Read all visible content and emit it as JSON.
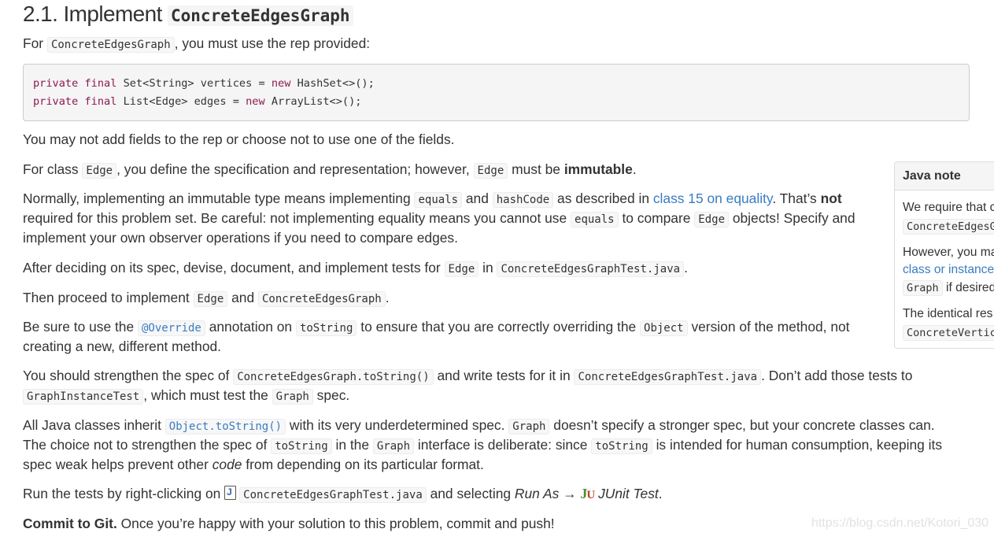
{
  "heading": {
    "prefix": "2.1. Implement",
    "code": "ConcreteEdgesGraph"
  },
  "intro": {
    "t1": "For",
    "c1": "ConcreteEdgesGraph",
    "t2": ", you must use the rep provided:"
  },
  "code_block": {
    "line1": {
      "kw1": "private",
      "kw2": "final",
      "mid": "Set<String> vertices =",
      "kw3": "new",
      "rest": "HashSet<>();"
    },
    "line2": {
      "kw1": "private",
      "kw2": "final",
      "mid": "List<Edge> edges =",
      "kw3": "new",
      "rest": "ArrayList<>();"
    }
  },
  "p_fields": "You may not add fields to the rep or choose not to use one of the fields.",
  "p_immutable": {
    "t1": "For class",
    "c1": "Edge",
    "t2": ", you define the specification and representation; however,",
    "c2": "Edge",
    "t3": "must be",
    "b1": "immutable",
    "t4": "."
  },
  "p_normally": {
    "l1": {
      "t1": "Normally, implementing an immutable type means implementing",
      "c1": "equals",
      "t2": "and",
      "c2": "hashCode",
      "t3": "as described in",
      "link": "class 15 on equality",
      "t4": ". That’s",
      "b1": "not"
    },
    "l2": {
      "t1": "required for this problem set. Be careful: not implementing equality means you cannot use",
      "c1": "equals",
      "t2": "to compare",
      "c2": "Edge",
      "t3": "objects! Specify and"
    },
    "l3": "implement your own observer operations if you need to compare edges."
  },
  "p_after": {
    "t1": "After deciding on its spec, devise, document, and implement tests for",
    "c1": "Edge",
    "t2": "in",
    "c2": "ConcreteEdgesGraphTest.java",
    "t3": "."
  },
  "p_then": {
    "t1": "Then proceed to implement",
    "c1": "Edge",
    "t2": "and",
    "c2": "ConcreteEdgesGraph",
    "t3": "."
  },
  "p_override": {
    "l1": {
      "t1": "Be sure to use the",
      "c1": "@Override",
      "t2": "annotation on",
      "c2": "toString",
      "t3": "to ensure that you are correctly overriding the",
      "c3": "Object",
      "t4": "version of the method, not"
    },
    "l2": "creating a new, different method."
  },
  "p_strengthen": {
    "l1": {
      "t1": "You should strengthen the spec of",
      "c1": "ConcreteEdgesGraph.toString()",
      "t2": "and write tests for it in",
      "c2": "ConcreteEdgesGraphTest.java",
      "t3": ". Don’t add those tests to"
    },
    "l2": {
      "c1": "GraphInstanceTest",
      "t1": ", which must test the",
      "c2": "Graph",
      "t2": "spec."
    }
  },
  "p_inherit": {
    "l1": {
      "t1": "All Java classes inherit",
      "c1": "Object.toString()",
      "t2": "with its very underdetermined spec.",
      "c2": "Graph",
      "t3": "doesn’t specify a stronger spec, but your concrete classes can."
    },
    "l2": {
      "t1": "The choice not to strengthen the spec of",
      "c1": "toString",
      "t2": "in the",
      "c2": "Graph",
      "t3": "interface is deliberate: since",
      "c3": "toString",
      "t4": "is intended for human consumption, keeping its"
    },
    "l3": {
      "t1": "spec weak helps prevent other",
      "i1": "code",
      "t2": "from depending on its particular format."
    }
  },
  "p_run": {
    "t1": "Run the tests by right-clicking on",
    "file_icon_letter": "J",
    "c1": "ConcreteEdgesGraphTest.java",
    "t2": "and selecting",
    "i1": "Run As",
    "arrow": "→",
    "ju_j": "J",
    "ju_u": "U",
    "i2": "JUnit Test",
    "t3": "."
  },
  "p_commit": {
    "b1": "Commit to Git.",
    "t1": "Once you’re happy with your solution to this problem, commit and push!"
  },
  "sidebar": {
    "title": "Java note",
    "s1": "We require that c",
    "s2": "ConcreteEdgesG",
    "s3": "However, you ma",
    "s4": "class or instance",
    "s5c": "Graph",
    "s5t": "if desired",
    "s6": "The identical res",
    "s7": "ConcreteVertic"
  },
  "watermark": "https://blog.csdn.net/Kotori_030",
  "colors": {
    "link": "#3a7cc1",
    "keyword": "#8d1a52",
    "text": "#333333",
    "code_bg": "#f5f5f5"
  }
}
